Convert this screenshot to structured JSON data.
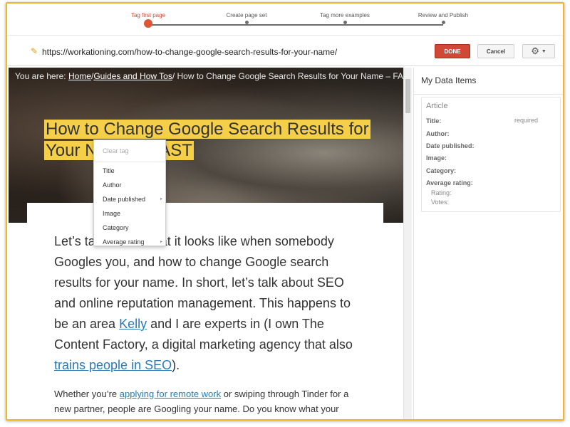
{
  "stepper": {
    "steps": [
      {
        "label": "Tag first page",
        "active": true
      },
      {
        "label": "Create page set",
        "active": false
      },
      {
        "label": "Tag more examples",
        "active": false
      },
      {
        "label": "Review and Publish",
        "active": false
      }
    ]
  },
  "toolbar": {
    "url": "https://workationing.com/how-to-change-google-search-results-for-your-name/",
    "done_label": "DONE",
    "cancel_label": "Cancel",
    "gear_icon": "gear-icon"
  },
  "page": {
    "breadcrumb": {
      "prefix": "You are here: ",
      "home": "Home",
      "sep1": "/",
      "guides": "Guides and How Tos",
      "sep2": "/ ",
      "current": "How to Change Google Search Results for Your Name – FAST"
    },
    "headline_line1": "How to Change Google Search Results for",
    "headline_line2": "Your Name – FAST",
    "intro": {
      "t1": "Let’s talk about what it looks like when somebody Googles you, and how to change Google search results for your name. In short, let’s talk about SEO and online reputation management. This happens to be an area ",
      "link1": "Kelly",
      "t2": " and I are experts in (I own The Content Factory, a digital marketing agency that also ",
      "link2": "trains people in SEO",
      "t3": ")."
    },
    "sub": {
      "t1": "Whether you’re ",
      "link1": "applying for remote work",
      "t2": " or swiping through Tinder for a new partner, people are Googling your name. Do you know what your"
    }
  },
  "context_menu": {
    "clear": "Clear tag",
    "items": [
      "Title",
      "Author",
      "Date published",
      "Image",
      "Category",
      "Average rating"
    ],
    "submenu_arrow": "▸"
  },
  "sidebar": {
    "title": "My Data Items",
    "item_type": "Article",
    "fields": {
      "title": "Title:",
      "title_status": "required",
      "author": "Author:",
      "date_published": "Date published:",
      "image": "Image:",
      "category": "Category:",
      "average_rating": "Average rating:",
      "rating": "Rating:",
      "votes": "Votes:"
    }
  },
  "colors": {
    "accent": "#dd5736",
    "done_button": "#d14836",
    "highlight": "#f6cf48",
    "link": "#2a7ab5",
    "frame": "#f1b62a"
  }
}
